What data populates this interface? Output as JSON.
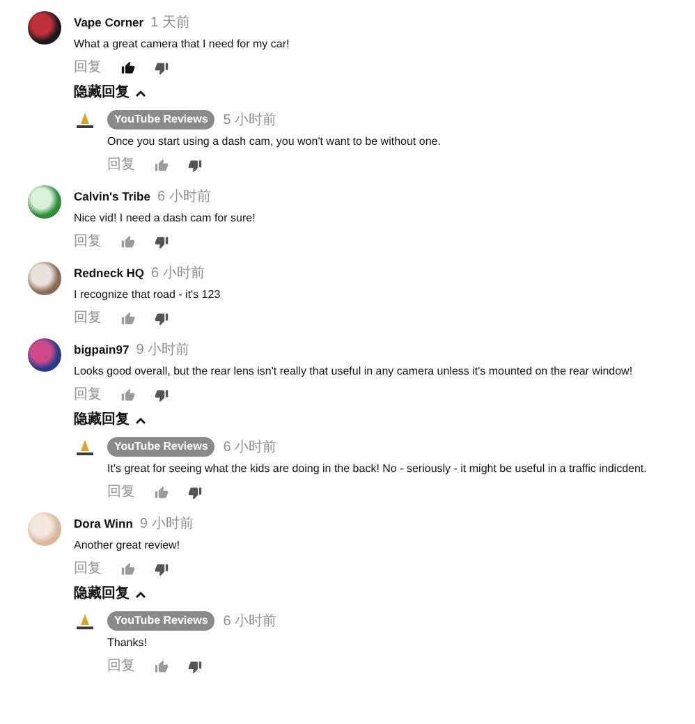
{
  "comments": [
    {
      "author": "Vape Corner",
      "time": "1 天前",
      "text": "What a great camera that I need for my car!",
      "reply_label": "回复",
      "liked": true,
      "replies_toggle": "隐藏回复",
      "replies": [
        {
          "author": "YouTube Reviews",
          "time": "5 小时前",
          "text": "Once you start using a dash cam, you won't want to be without one.",
          "reply_label": "回复",
          "liked": false
        }
      ]
    },
    {
      "author": "Calvin's Tribe",
      "time": "6 小时前",
      "text": "Nice vid!  I need a dash cam for sure!",
      "reply_label": "回复",
      "liked": false
    },
    {
      "author": "Redneck HQ",
      "time": "6 小时前",
      "text": "I recognize that road - it's 123",
      "reply_label": "回复",
      "liked": false
    },
    {
      "author": "bigpain97",
      "time": "9 小时前",
      "text": "Looks good overall, but the rear lens isn't really that useful in any camera unless it's mounted on the rear window!",
      "reply_label": "回复",
      "liked": false,
      "replies_toggle": "隐藏回复",
      "replies": [
        {
          "author": "YouTube Reviews",
          "time": "6 小时前",
          "text": "It's great for seeing what the kids are doing in the back!  No - seriously - it might be useful in a traffic indicdent.",
          "reply_label": "回复",
          "liked": false
        }
      ]
    },
    {
      "author": "Dora Winn",
      "time": "9 小时前",
      "text": "Another great review!",
      "reply_label": "回复",
      "liked": false,
      "replies_toggle": "隐藏回复",
      "replies": [
        {
          "author": "YouTube Reviews",
          "time": "6 小时前",
          "text": "Thanks!",
          "reply_label": "回复",
          "liked": false
        }
      ]
    }
  ]
}
